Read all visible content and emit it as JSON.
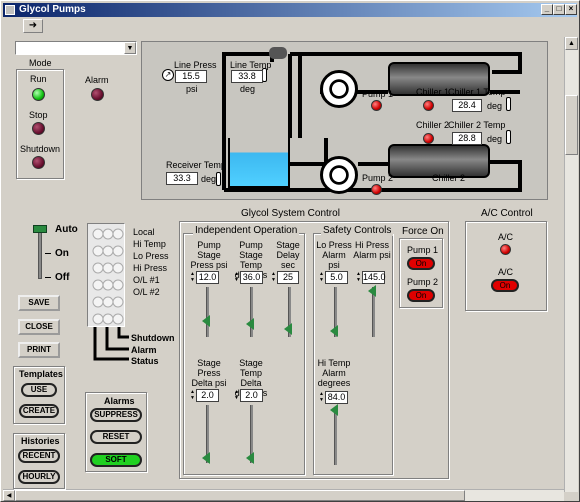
{
  "window": {
    "title": "Glycol Pumps",
    "controls": [
      "_",
      "□",
      "×"
    ]
  },
  "mode": {
    "label": "Mode",
    "value": ""
  },
  "status_lights": {
    "run": "Run",
    "stop": "Stop",
    "shutdown": "Shutdown",
    "alarm": "Alarm"
  },
  "process": {
    "line_press_label": "Line Press",
    "line_press_value": "15.5",
    "line_press_unit": "psi",
    "line_temp_label": "Line Temp",
    "line_temp_value": "33.8",
    "line_temp_unit": "deg",
    "receiver_temp_label": "Receiver Temp",
    "receiver_temp_value": "33.3",
    "receiver_temp_unit": "deg",
    "pump1": "Pump 1",
    "pump2": "Pump 2",
    "chiller1": "Chiller 1",
    "chiller2": "Chiller 2",
    "chiller1_temp_label": "Chiller 1 Temp",
    "chiller1_temp_value": "28.4",
    "chiller1_temp_unit": "deg",
    "chiller2_temp_label": "Chiller 2 Temp",
    "chiller2_temp_value": "28.8",
    "chiller2_temp_unit": "deg",
    "chiller2_bottom": "Chiller 2"
  },
  "switch": {
    "auto": "Auto",
    "on": "On",
    "off": "Off"
  },
  "legend": {
    "items": [
      "Local",
      "Hi Temp",
      "Lo Press",
      "Hi Press",
      "O/L #1",
      "O/L #2"
    ],
    "shutdown": "Shutdown",
    "alarm": "Alarm",
    "status": "Status"
  },
  "buttons": {
    "save": "SAVE",
    "close": "CLOSE",
    "print": "PRINT"
  },
  "templates": {
    "title": "Templates",
    "use": "USE",
    "create": "CREATE"
  },
  "histories": {
    "title": "Histories",
    "recent": "RECENT",
    "hourly": "HOURLY"
  },
  "alarms": {
    "title": "Alarms",
    "suppress": "SUPPRESS",
    "reset": "RESET",
    "soft": "SOFT"
  },
  "glycol": {
    "title": "Glycol System Control",
    "independent": {
      "title": "Independent Operation",
      "pump_stage_press_label": "Pump Stage Press psi",
      "pump_stage_press_value": "12.0",
      "pump_stage_press_level": 0.5,
      "pump_stage_temp_label": "Pump Stage Temp degrees",
      "pump_stage_temp_value": "36.0",
      "pump_stage_temp_level": 0.43,
      "stage_delay_label": "Stage Delay sec",
      "stage_delay_value": "25",
      "stage_delay_level": 0.38,
      "stage_press_delta_label": "Stage Press Delta psi",
      "stage_press_delta_value": "2.0",
      "stage_press_delta_level": 0.08,
      "stage_temp_delta_label": "Stage Temp Delta degrees",
      "stage_temp_delta_value": "2.0",
      "stage_temp_delta_level": 0.08
    },
    "safety": {
      "title": "Safety Controls",
      "lo_press_label": "Lo Press Alarm psi",
      "lo_press_value": "5.0",
      "lo_press_level": 0.32,
      "hi_press_label": "Hi Press Alarm psi",
      "hi_press_value": "145.0",
      "hi_press_level": 0.93,
      "hi_temp_label": "Hi Temp Alarm degrees",
      "hi_temp_value": "84.0",
      "hi_temp_level": 0.84
    },
    "force_on": {
      "title": "Force On",
      "pump1": "Pump 1",
      "pump1_state": "On",
      "pump2": "Pump 2",
      "pump2_state": "On"
    }
  },
  "ac": {
    "title": "A/C Control",
    "label1": "A/C",
    "label2": "A/C",
    "state": "On"
  }
}
